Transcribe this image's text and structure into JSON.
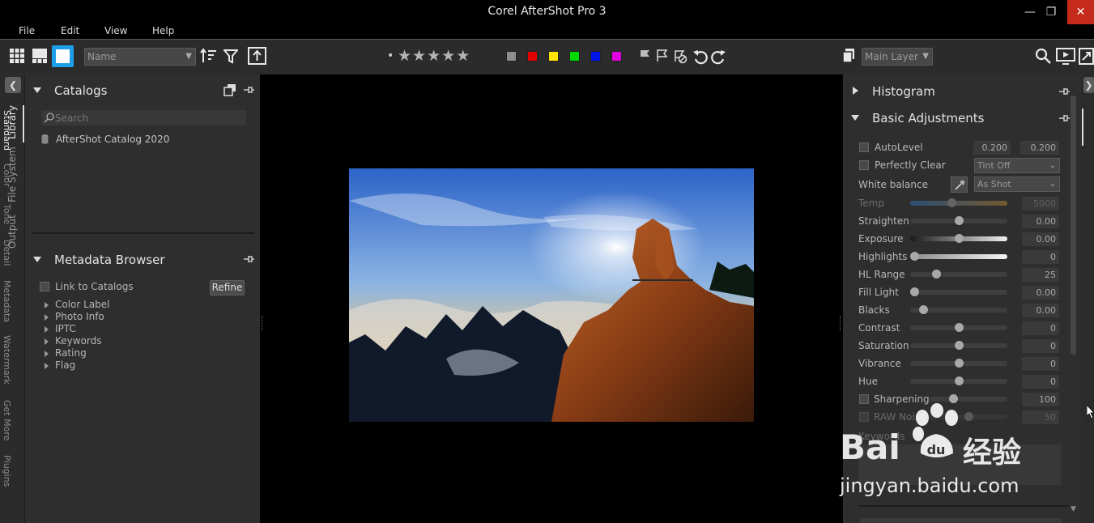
{
  "app": {
    "title": "Corel AfterShot Pro 3"
  },
  "window": {
    "minimize": "—",
    "restore": "❐",
    "close": "✕"
  },
  "menu": {
    "file": "File",
    "edit": "Edit",
    "view": "View",
    "help": "Help"
  },
  "toolbar": {
    "sort_select": "Name",
    "layer_select": "Main Layer",
    "icons": [
      "grid-view-icon",
      "filmstrip-view-icon",
      "single-view-icon",
      "sort-icon",
      "filter-icon",
      "export-icon",
      "star-rating-icon",
      "flag-icon",
      "rotate-left-icon",
      "rotate-right-icon",
      "layers-icon",
      "search-icon",
      "slideshow-icon",
      "fullscreen-icon"
    ],
    "color_labels": [
      "#8e8e8e",
      "#e00000",
      "#ffe500",
      "#00d800",
      "#0014e8",
      "#e000e0"
    ]
  },
  "left_tabs": {
    "library": "Library",
    "file_system": "File System",
    "output": "Output"
  },
  "catalogs": {
    "title": "Catalogs",
    "search_placeholder": "Search",
    "items": [
      {
        "label": "AfterShot Catalog 2020"
      }
    ]
  },
  "metadata_browser": {
    "title": "Metadata Browser",
    "link_label": "Link to Catalogs",
    "refine_label": "Refine",
    "items": [
      {
        "label": "Color Label"
      },
      {
        "label": "Photo Info"
      },
      {
        "label": "IPTC"
      },
      {
        "label": "Keywords"
      },
      {
        "label": "Rating"
      },
      {
        "label": "Flag"
      }
    ]
  },
  "right_panel": {
    "histogram_title": "Histogram",
    "basic_title": "Basic Adjustments",
    "autolevel": {
      "label": "AutoLevel",
      "v1": "0.200",
      "v2": "0.200"
    },
    "perfectly_clear": {
      "label": "Perfectly Clear",
      "option": "Tint Off"
    },
    "white_balance": {
      "label": "White balance",
      "option": "As Shot"
    },
    "sliders": [
      {
        "label": "Temp",
        "value": "5000",
        "level": 0.42,
        "disabled": true
      },
      {
        "label": "Straighten",
        "value": "0.00",
        "level": 0.5
      },
      {
        "label": "Exposure",
        "value": "0.00",
        "level": 0.5
      },
      {
        "label": "Highlights",
        "value": "0",
        "level": 0.0
      },
      {
        "label": "HL Range",
        "value": "25",
        "level": 0.25
      },
      {
        "label": "Fill Light",
        "value": "0.00",
        "level": 0.0
      },
      {
        "label": "Blacks",
        "value": "0.00",
        "level": 0.1
      },
      {
        "label": "Contrast",
        "value": "0",
        "level": 0.5
      },
      {
        "label": "Saturation",
        "value": "0",
        "level": 0.5
      },
      {
        "label": "Vibrance",
        "value": "0",
        "level": 0.5
      },
      {
        "label": "Hue",
        "value": "0",
        "level": 0.5
      }
    ],
    "sharpening": {
      "label": "Sharpening",
      "value": "100",
      "level": 0.28
    },
    "raw_noise": {
      "label": "RAW Noise",
      "value": "50",
      "level": 0.5
    },
    "keywords_label": "Keywords"
  },
  "right_tabs": {
    "standard": "Standard",
    "color": "Color",
    "tone": "Tone",
    "detail": "Detail",
    "metadata": "Metadata",
    "watermark": "Watermark",
    "get_more": "Get More",
    "plugins": "Plugins"
  },
  "watermark": {
    "brand": "Bai",
    "brand2": "经验",
    "url": "jingyan.baidu.com"
  }
}
